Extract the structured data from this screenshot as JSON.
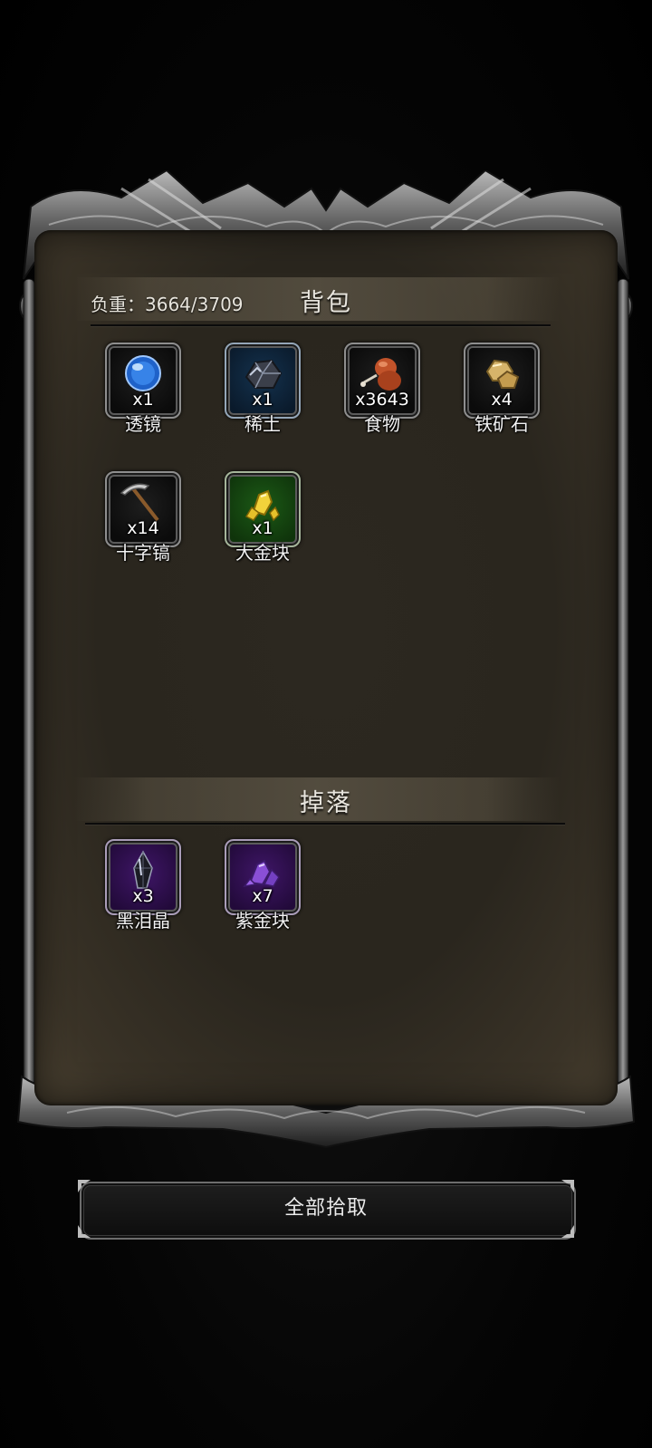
{
  "backpack": {
    "title": "背包",
    "weight_text": "负重：3664/3709",
    "items": [
      {
        "name": "透镜",
        "count": "x1",
        "rarity": "grey",
        "icon": "lens-icon"
      },
      {
        "name": "稀土",
        "count": "x1",
        "rarity": "blue",
        "icon": "rare-earth-icon"
      },
      {
        "name": "食物",
        "count": "x3643",
        "rarity": "grey",
        "icon": "food-icon"
      },
      {
        "name": "铁矿石",
        "count": "x4",
        "rarity": "grey",
        "icon": "iron-ore-icon"
      },
      {
        "name": "十字镐",
        "count": "x14",
        "rarity": "grey",
        "icon": "pickaxe-icon"
      },
      {
        "name": "大金块",
        "count": "x1",
        "rarity": "green",
        "icon": "gold-nugget-icon"
      }
    ]
  },
  "drops": {
    "title": "掉落",
    "items": [
      {
        "name": "黑泪晶",
        "count": "x3",
        "rarity": "purple",
        "icon": "black-tear-crystal-icon"
      },
      {
        "name": "紫金块",
        "count": "x7",
        "rarity": "purple",
        "icon": "purple-gold-icon"
      }
    ]
  },
  "actions": {
    "collect_all_label": "全部拾取"
  }
}
